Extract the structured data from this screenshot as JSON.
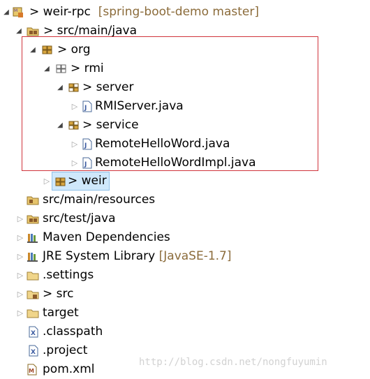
{
  "tree": {
    "project": {
      "prefix": "> ",
      "name": "weir-rpc",
      "decoration": "[spring-boot-demo master]"
    },
    "items": [
      {
        "prefix": "> ",
        "label": "src/main/java"
      },
      {
        "prefix": "> ",
        "label": "org"
      },
      {
        "prefix": "> ",
        "label": "rmi"
      },
      {
        "prefix": "> ",
        "label": "server"
      },
      {
        "prefix": "",
        "label": "RMIServer.java"
      },
      {
        "prefix": "> ",
        "label": "service"
      },
      {
        "prefix": "",
        "label": "RemoteHelloWord.java"
      },
      {
        "prefix": "",
        "label": "RemoteHelloWordImpl.java"
      },
      {
        "prefix": "> ",
        "label": "weir"
      },
      {
        "prefix": "",
        "label": "src/main/resources"
      },
      {
        "prefix": "",
        "label": "src/test/java"
      },
      {
        "prefix": "",
        "label": "Maven Dependencies"
      },
      {
        "prefix": "",
        "label": "JRE System Library",
        "decoration": "[JavaSE-1.7]"
      },
      {
        "prefix": "",
        "label": ".settings"
      },
      {
        "prefix": "> ",
        "label": "src"
      },
      {
        "prefix": "",
        "label": "target"
      },
      {
        "prefix": "",
        "label": ".classpath"
      },
      {
        "prefix": "",
        "label": ".project"
      },
      {
        "prefix": "",
        "label": "pom.xml"
      }
    ]
  },
  "watermark": "http://blog.csdn.net/nongfuyumin",
  "colors": {
    "selection": "#cfe8fb",
    "highlight_border": "#d0343c",
    "decoration": "#8b6b3a"
  }
}
